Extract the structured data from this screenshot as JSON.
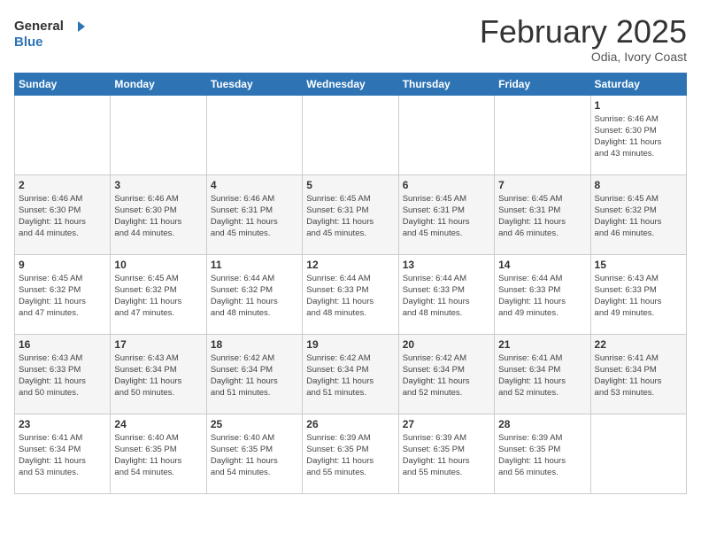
{
  "header": {
    "logo_general": "General",
    "logo_blue": "Blue",
    "month_title": "February 2025",
    "location": "Odia, Ivory Coast"
  },
  "days_of_week": [
    "Sunday",
    "Monday",
    "Tuesday",
    "Wednesday",
    "Thursday",
    "Friday",
    "Saturday"
  ],
  "weeks": [
    [
      {
        "day": "",
        "info": ""
      },
      {
        "day": "",
        "info": ""
      },
      {
        "day": "",
        "info": ""
      },
      {
        "day": "",
        "info": ""
      },
      {
        "day": "",
        "info": ""
      },
      {
        "day": "",
        "info": ""
      },
      {
        "day": "1",
        "info": "Sunrise: 6:46 AM\nSunset: 6:30 PM\nDaylight: 11 hours\nand 43 minutes."
      }
    ],
    [
      {
        "day": "2",
        "info": "Sunrise: 6:46 AM\nSunset: 6:30 PM\nDaylight: 11 hours\nand 44 minutes."
      },
      {
        "day": "3",
        "info": "Sunrise: 6:46 AM\nSunset: 6:30 PM\nDaylight: 11 hours\nand 44 minutes."
      },
      {
        "day": "4",
        "info": "Sunrise: 6:46 AM\nSunset: 6:31 PM\nDaylight: 11 hours\nand 45 minutes."
      },
      {
        "day": "5",
        "info": "Sunrise: 6:45 AM\nSunset: 6:31 PM\nDaylight: 11 hours\nand 45 minutes."
      },
      {
        "day": "6",
        "info": "Sunrise: 6:45 AM\nSunset: 6:31 PM\nDaylight: 11 hours\nand 45 minutes."
      },
      {
        "day": "7",
        "info": "Sunrise: 6:45 AM\nSunset: 6:31 PM\nDaylight: 11 hours\nand 46 minutes."
      },
      {
        "day": "8",
        "info": "Sunrise: 6:45 AM\nSunset: 6:32 PM\nDaylight: 11 hours\nand 46 minutes."
      }
    ],
    [
      {
        "day": "9",
        "info": "Sunrise: 6:45 AM\nSunset: 6:32 PM\nDaylight: 11 hours\nand 47 minutes."
      },
      {
        "day": "10",
        "info": "Sunrise: 6:45 AM\nSunset: 6:32 PM\nDaylight: 11 hours\nand 47 minutes."
      },
      {
        "day": "11",
        "info": "Sunrise: 6:44 AM\nSunset: 6:32 PM\nDaylight: 11 hours\nand 48 minutes."
      },
      {
        "day": "12",
        "info": "Sunrise: 6:44 AM\nSunset: 6:33 PM\nDaylight: 11 hours\nand 48 minutes."
      },
      {
        "day": "13",
        "info": "Sunrise: 6:44 AM\nSunset: 6:33 PM\nDaylight: 11 hours\nand 48 minutes."
      },
      {
        "day": "14",
        "info": "Sunrise: 6:44 AM\nSunset: 6:33 PM\nDaylight: 11 hours\nand 49 minutes."
      },
      {
        "day": "15",
        "info": "Sunrise: 6:43 AM\nSunset: 6:33 PM\nDaylight: 11 hours\nand 49 minutes."
      }
    ],
    [
      {
        "day": "16",
        "info": "Sunrise: 6:43 AM\nSunset: 6:33 PM\nDaylight: 11 hours\nand 50 minutes."
      },
      {
        "day": "17",
        "info": "Sunrise: 6:43 AM\nSunset: 6:34 PM\nDaylight: 11 hours\nand 50 minutes."
      },
      {
        "day": "18",
        "info": "Sunrise: 6:42 AM\nSunset: 6:34 PM\nDaylight: 11 hours\nand 51 minutes."
      },
      {
        "day": "19",
        "info": "Sunrise: 6:42 AM\nSunset: 6:34 PM\nDaylight: 11 hours\nand 51 minutes."
      },
      {
        "day": "20",
        "info": "Sunrise: 6:42 AM\nSunset: 6:34 PM\nDaylight: 11 hours\nand 52 minutes."
      },
      {
        "day": "21",
        "info": "Sunrise: 6:41 AM\nSunset: 6:34 PM\nDaylight: 11 hours\nand 52 minutes."
      },
      {
        "day": "22",
        "info": "Sunrise: 6:41 AM\nSunset: 6:34 PM\nDaylight: 11 hours\nand 53 minutes."
      }
    ],
    [
      {
        "day": "23",
        "info": "Sunrise: 6:41 AM\nSunset: 6:34 PM\nDaylight: 11 hours\nand 53 minutes."
      },
      {
        "day": "24",
        "info": "Sunrise: 6:40 AM\nSunset: 6:35 PM\nDaylight: 11 hours\nand 54 minutes."
      },
      {
        "day": "25",
        "info": "Sunrise: 6:40 AM\nSunset: 6:35 PM\nDaylight: 11 hours\nand 54 minutes."
      },
      {
        "day": "26",
        "info": "Sunrise: 6:39 AM\nSunset: 6:35 PM\nDaylight: 11 hours\nand 55 minutes."
      },
      {
        "day": "27",
        "info": "Sunrise: 6:39 AM\nSunset: 6:35 PM\nDaylight: 11 hours\nand 55 minutes."
      },
      {
        "day": "28",
        "info": "Sunrise: 6:39 AM\nSunset: 6:35 PM\nDaylight: 11 hours\nand 56 minutes."
      },
      {
        "day": "",
        "info": ""
      }
    ]
  ]
}
